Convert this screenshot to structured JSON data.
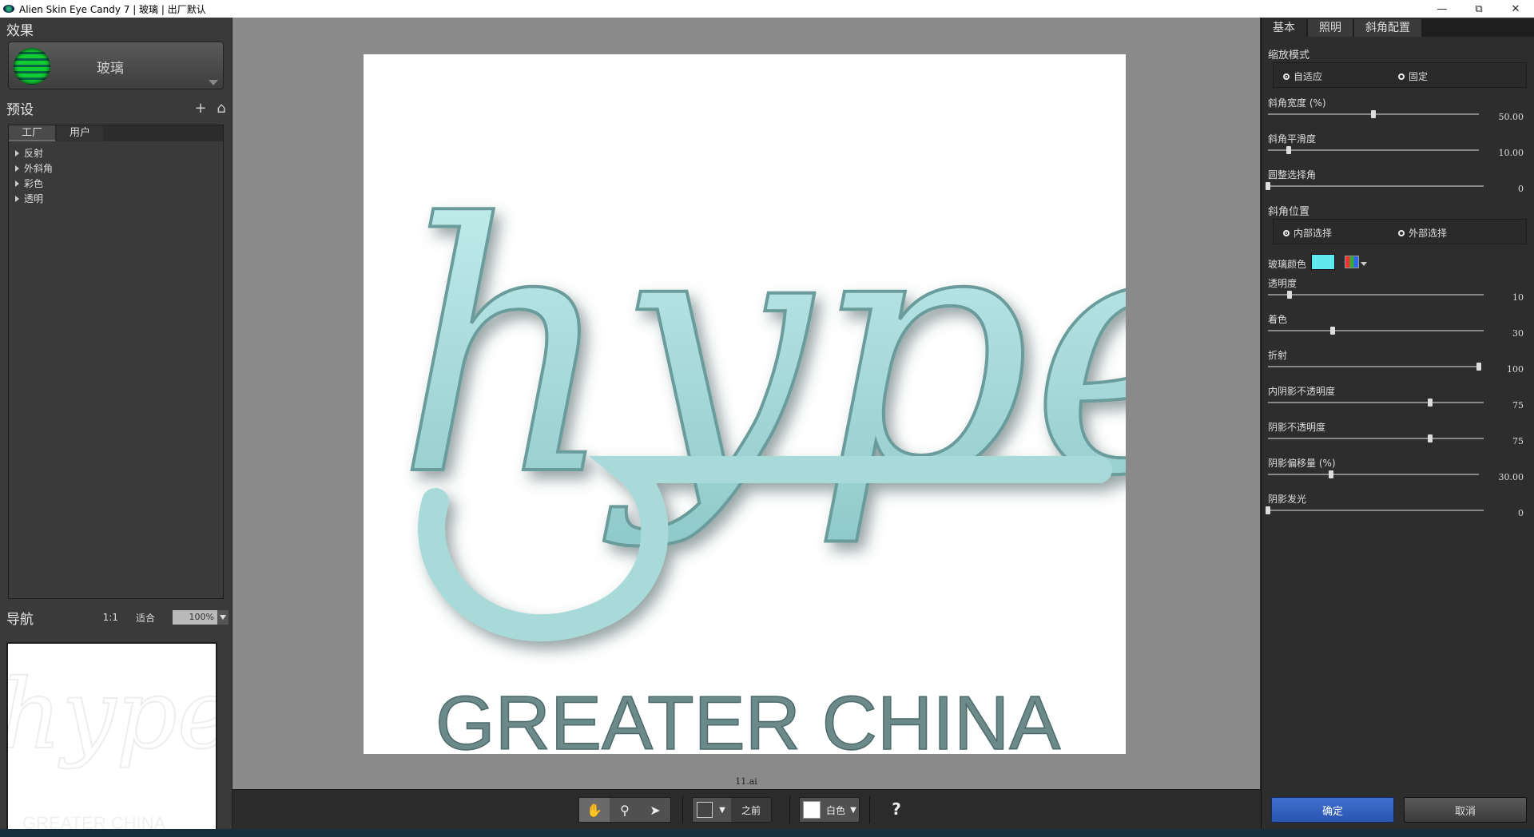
{
  "window": {
    "title": "Alien Skin Eye Candy 7 | 玻璃 | 出厂默认"
  },
  "left": {
    "effects_title": "效果",
    "effect_name": "玻璃",
    "presets_title": "预设",
    "tabs": [
      "工厂",
      "用户"
    ],
    "tree": [
      "反射",
      "外斜角",
      "彩色",
      "透明"
    ],
    "nav_title": "导航",
    "zoom_1to1": "1:1",
    "zoom_fit": "适合",
    "zoom_value": "100%"
  },
  "canvas": {
    "file_name": "11.ai",
    "artwork_word": "hype",
    "artwork_caption": "GREATER CHINA"
  },
  "toolbar": {
    "before_label": "之前",
    "bg_label": "白色",
    "help": "?"
  },
  "right": {
    "tabs": [
      "基本",
      "照明",
      "斜角配置"
    ],
    "zoom_mode_label": "缩放模式",
    "zoom_mode_options": [
      "自适应",
      "固定"
    ],
    "bevel_width_label": "斜角宽度 (%)",
    "bevel_width_value": "50.00",
    "bevel_width_frac": 0.5,
    "bevel_smooth_label": "斜角平滑度",
    "bevel_smooth_value": "10.00",
    "bevel_smooth_frac": 0.1,
    "round_corners_label": "圆整选择角",
    "round_corners_value": "0",
    "round_corners_frac": 0.0,
    "bevel_position_label": "斜角位置",
    "bevel_position_options": [
      "内部选择",
      "外部选择"
    ],
    "glass_color_label": "玻璃颜色",
    "glass_color": "#5fe8ee",
    "opacity_label": "透明度",
    "opacity_value": "10",
    "opacity_frac": 0.1,
    "tint_label": "着色",
    "tint_value": "30",
    "tint_frac": 0.3,
    "refraction_label": "折射",
    "refraction_value": "100",
    "refraction_frac": 1.0,
    "inner_shadow_label": "内阴影不透明度",
    "inner_shadow_value": "75",
    "inner_shadow_frac": 0.75,
    "shadow_opacity_label": "阴影不透明度",
    "shadow_opacity_value": "75",
    "shadow_opacity_frac": 0.75,
    "shadow_offset_label": "阴影偏移量 (%)",
    "shadow_offset_value": "30.00",
    "shadow_offset_frac": 0.3,
    "shadow_glow_label": "阴影发光",
    "shadow_glow_value": "0",
    "shadow_glow_frac": 0.0,
    "ok_label": "确定",
    "cancel_label": "取消"
  }
}
